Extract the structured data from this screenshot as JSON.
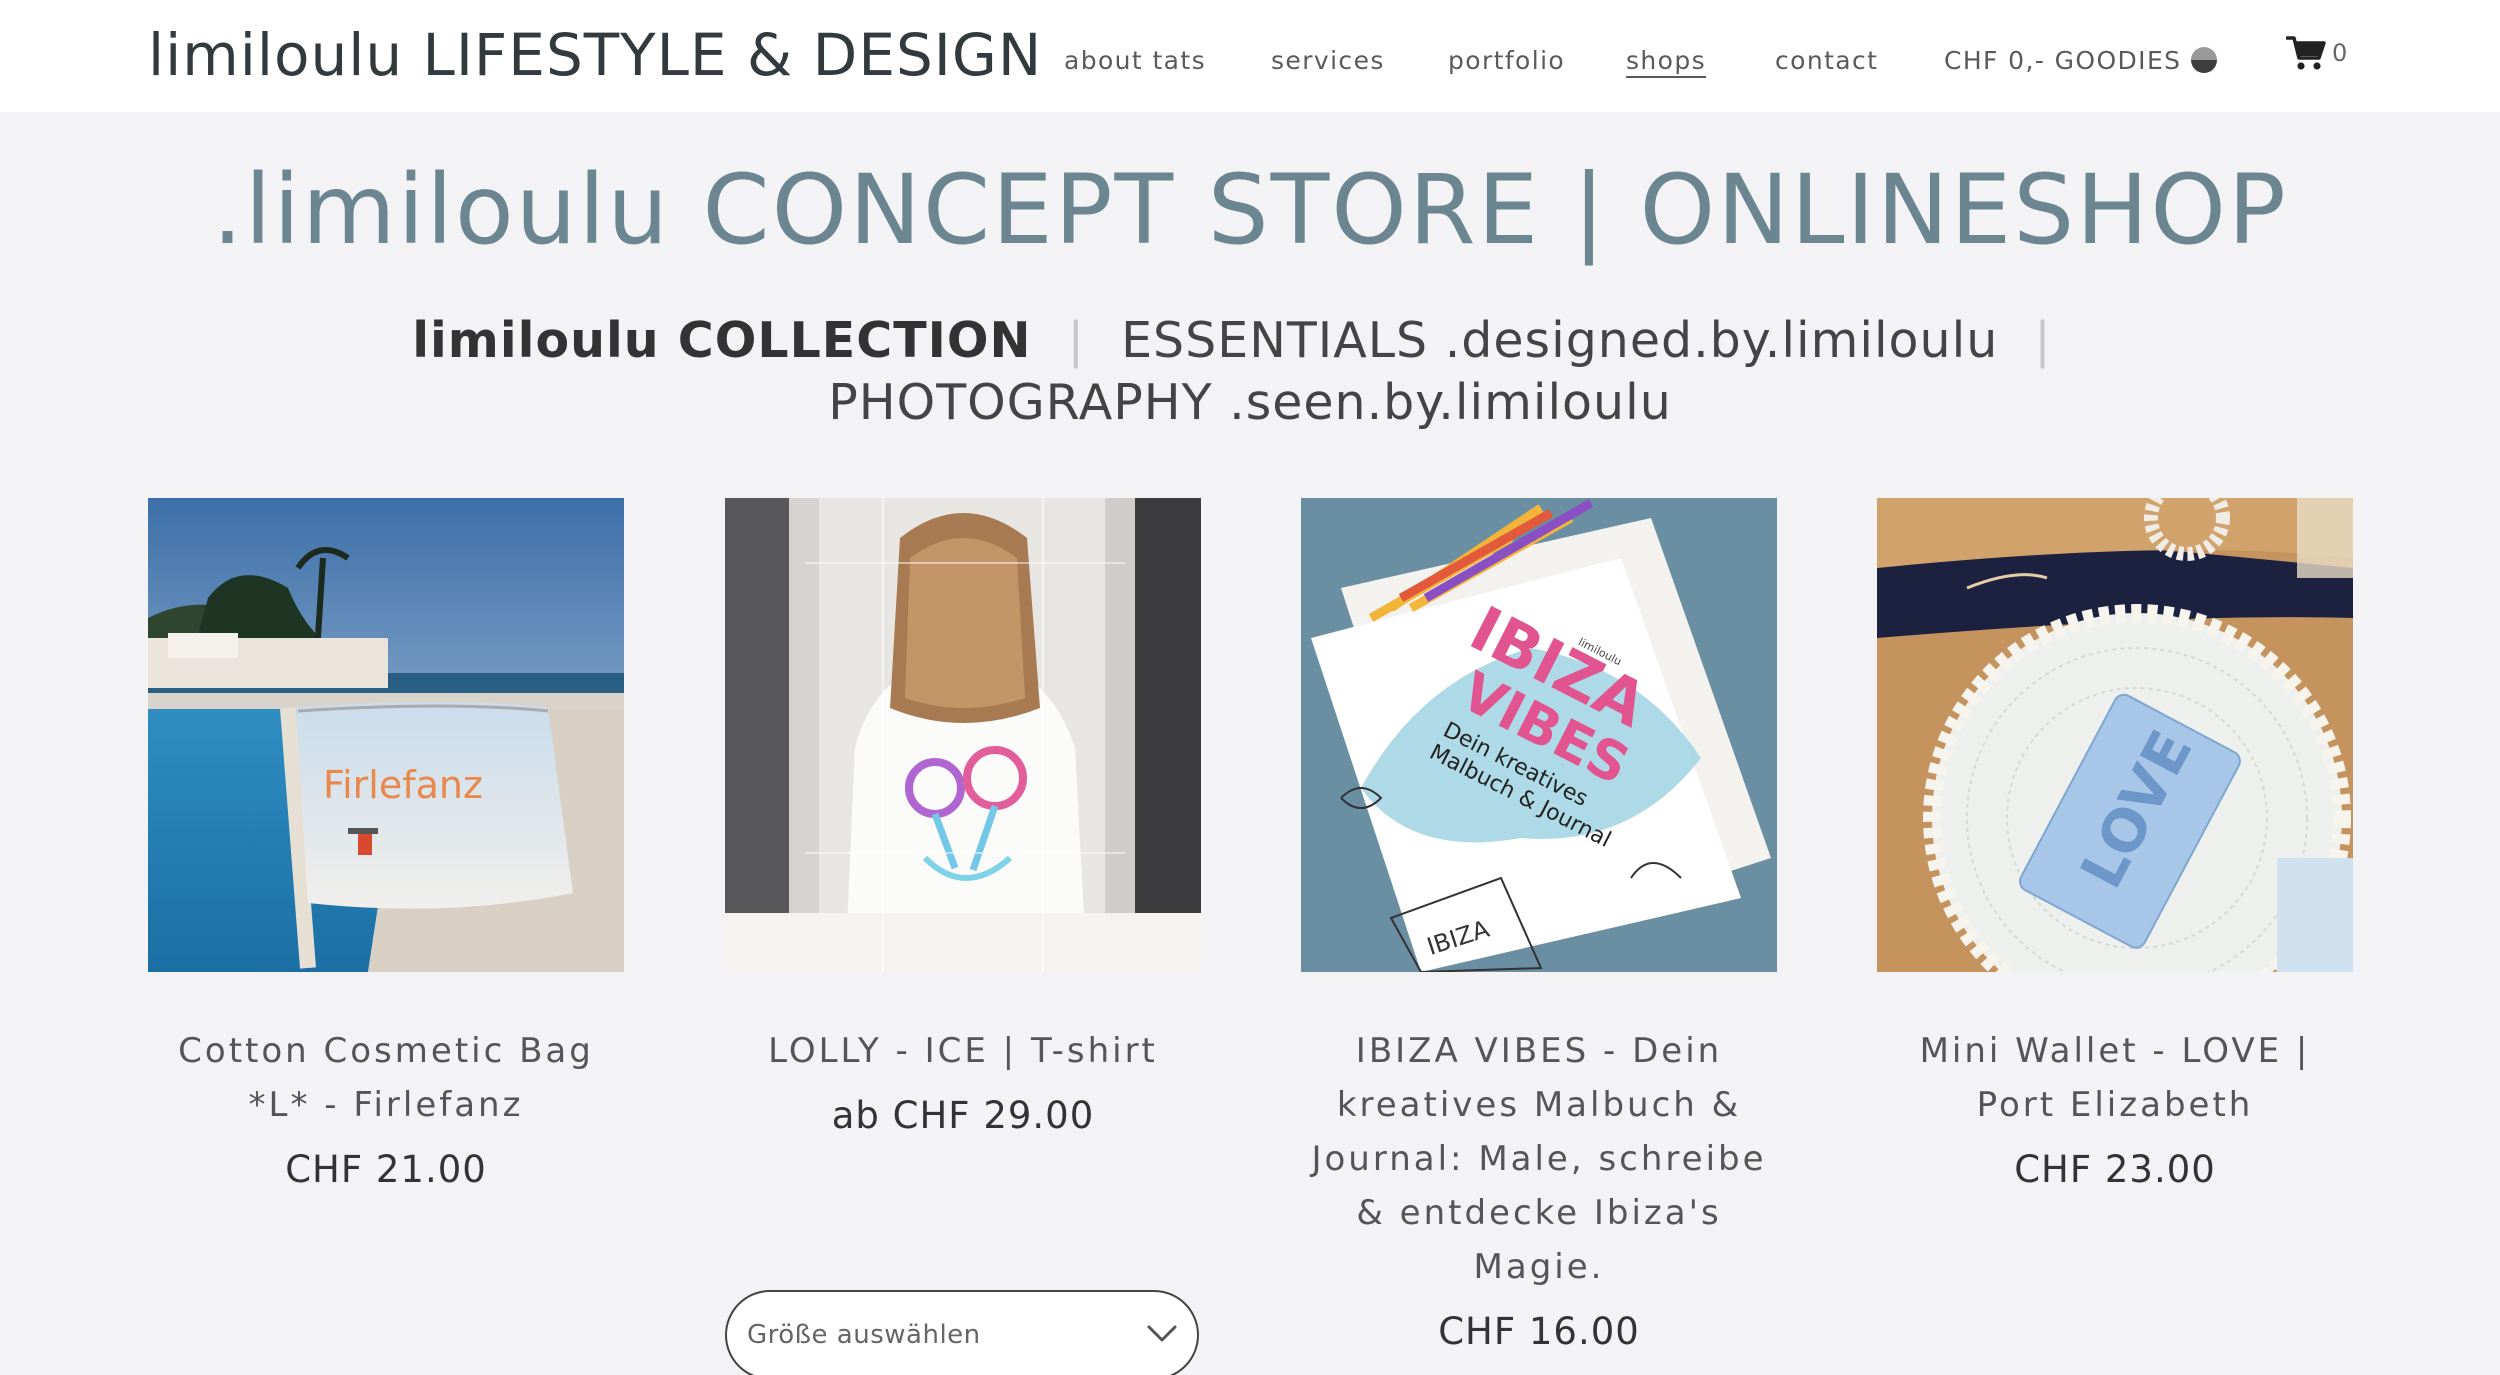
{
  "header": {
    "logo": "limiloulu LIFESTYLE & DESIGN",
    "nav": [
      {
        "label": "about tats"
      },
      {
        "label": "services"
      },
      {
        "label": "portfolio"
      },
      {
        "label": "shops"
      },
      {
        "label": "contact"
      },
      {
        "label": "CHF 0,- GOODIES"
      }
    ],
    "cart_count": "0"
  },
  "page_title": ".limiloulu CONCEPT STORE | ONLINESHOP",
  "collections": {
    "collection": "limiloulu COLLECTION",
    "essentials": "ESSENTIALS .designed.by.limiloulu",
    "photography": "PHOTOGRAPHY .seen.by.limiloulu",
    "separator": "|"
  },
  "products": [
    {
      "name": "Cotton Cosmetic Bag *L* - Firlefanz",
      "price": "CHF 21.00",
      "bag_text": "Firlefanz"
    },
    {
      "name": "LOLLY - ICE | T-shirt",
      "price": "ab CHF 29.00",
      "size_placeholder": "Größe auswählen"
    },
    {
      "name": "IBIZA VIBES - Dein kreatives Malbuch & Journal: Male, schreibe & entdecke Ibiza's Magie.",
      "price": "CHF 16.00",
      "book_title_1": "IBIZA",
      "book_title_2": "VIBES",
      "book_subtitle_1": "Dein kreatives",
      "book_subtitle_2": "Malbuch & Journal",
      "book_brand": "limiloulu",
      "book_sketch_word": "IBIZA"
    },
    {
      "name": "Mini Wallet - LOVE | Port Elizabeth",
      "price": "CHF 23.00",
      "wallet_text": "LOVE"
    }
  ],
  "colors": {
    "title": "#6b8591",
    "nav_text": "#5a5a5a",
    "background": "#f3f3f5"
  }
}
